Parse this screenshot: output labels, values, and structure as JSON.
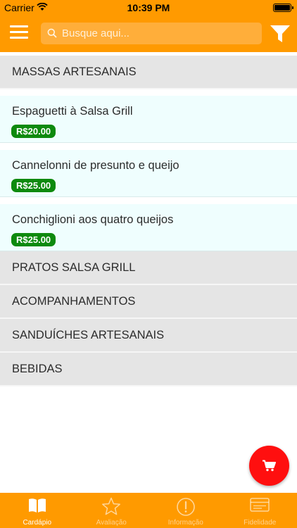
{
  "status_bar": {
    "carrier": "Carrier",
    "time": "10:39 PM"
  },
  "header": {
    "search_placeholder": "Busque aqui..."
  },
  "categories": [
    {
      "title": "MASSAS ARTESANAIS",
      "expanded": true,
      "items": [
        {
          "name": "Espaguetti à Salsa Grill",
          "price": "R$20.00"
        },
        {
          "name": "Cannelonni de presunto e queijo",
          "price": "R$25.00"
        },
        {
          "name": "Conchiglioni aos quatro queijos",
          "price": "R$25.00"
        }
      ]
    },
    {
      "title": "PRATOS SALSA GRILL"
    },
    {
      "title": "ACOMPANHAMENTOS"
    },
    {
      "title": "SANDUÍCHES ARTESANAIS"
    },
    {
      "title": "BEBIDAS"
    }
  ],
  "tabs": [
    {
      "label": "Cardápio",
      "icon": "book-icon",
      "active": true
    },
    {
      "label": "Avaliação",
      "icon": "star-icon",
      "active": false
    },
    {
      "label": "Informação",
      "icon": "info-icon",
      "active": false
    },
    {
      "label": "Fidelidade",
      "icon": "card-icon",
      "active": false
    }
  ],
  "colors": {
    "accent": "#ff9a00",
    "price_badge": "#0e8a0e",
    "cart_button": "#ff0f0f",
    "category_bg": "#e5e5e5",
    "item_bg": "#effefe"
  },
  "icons": {
    "menu": "hamburger-menu-icon",
    "search": "search-icon",
    "filter": "filter-icon",
    "cart": "shopping-cart-icon"
  }
}
